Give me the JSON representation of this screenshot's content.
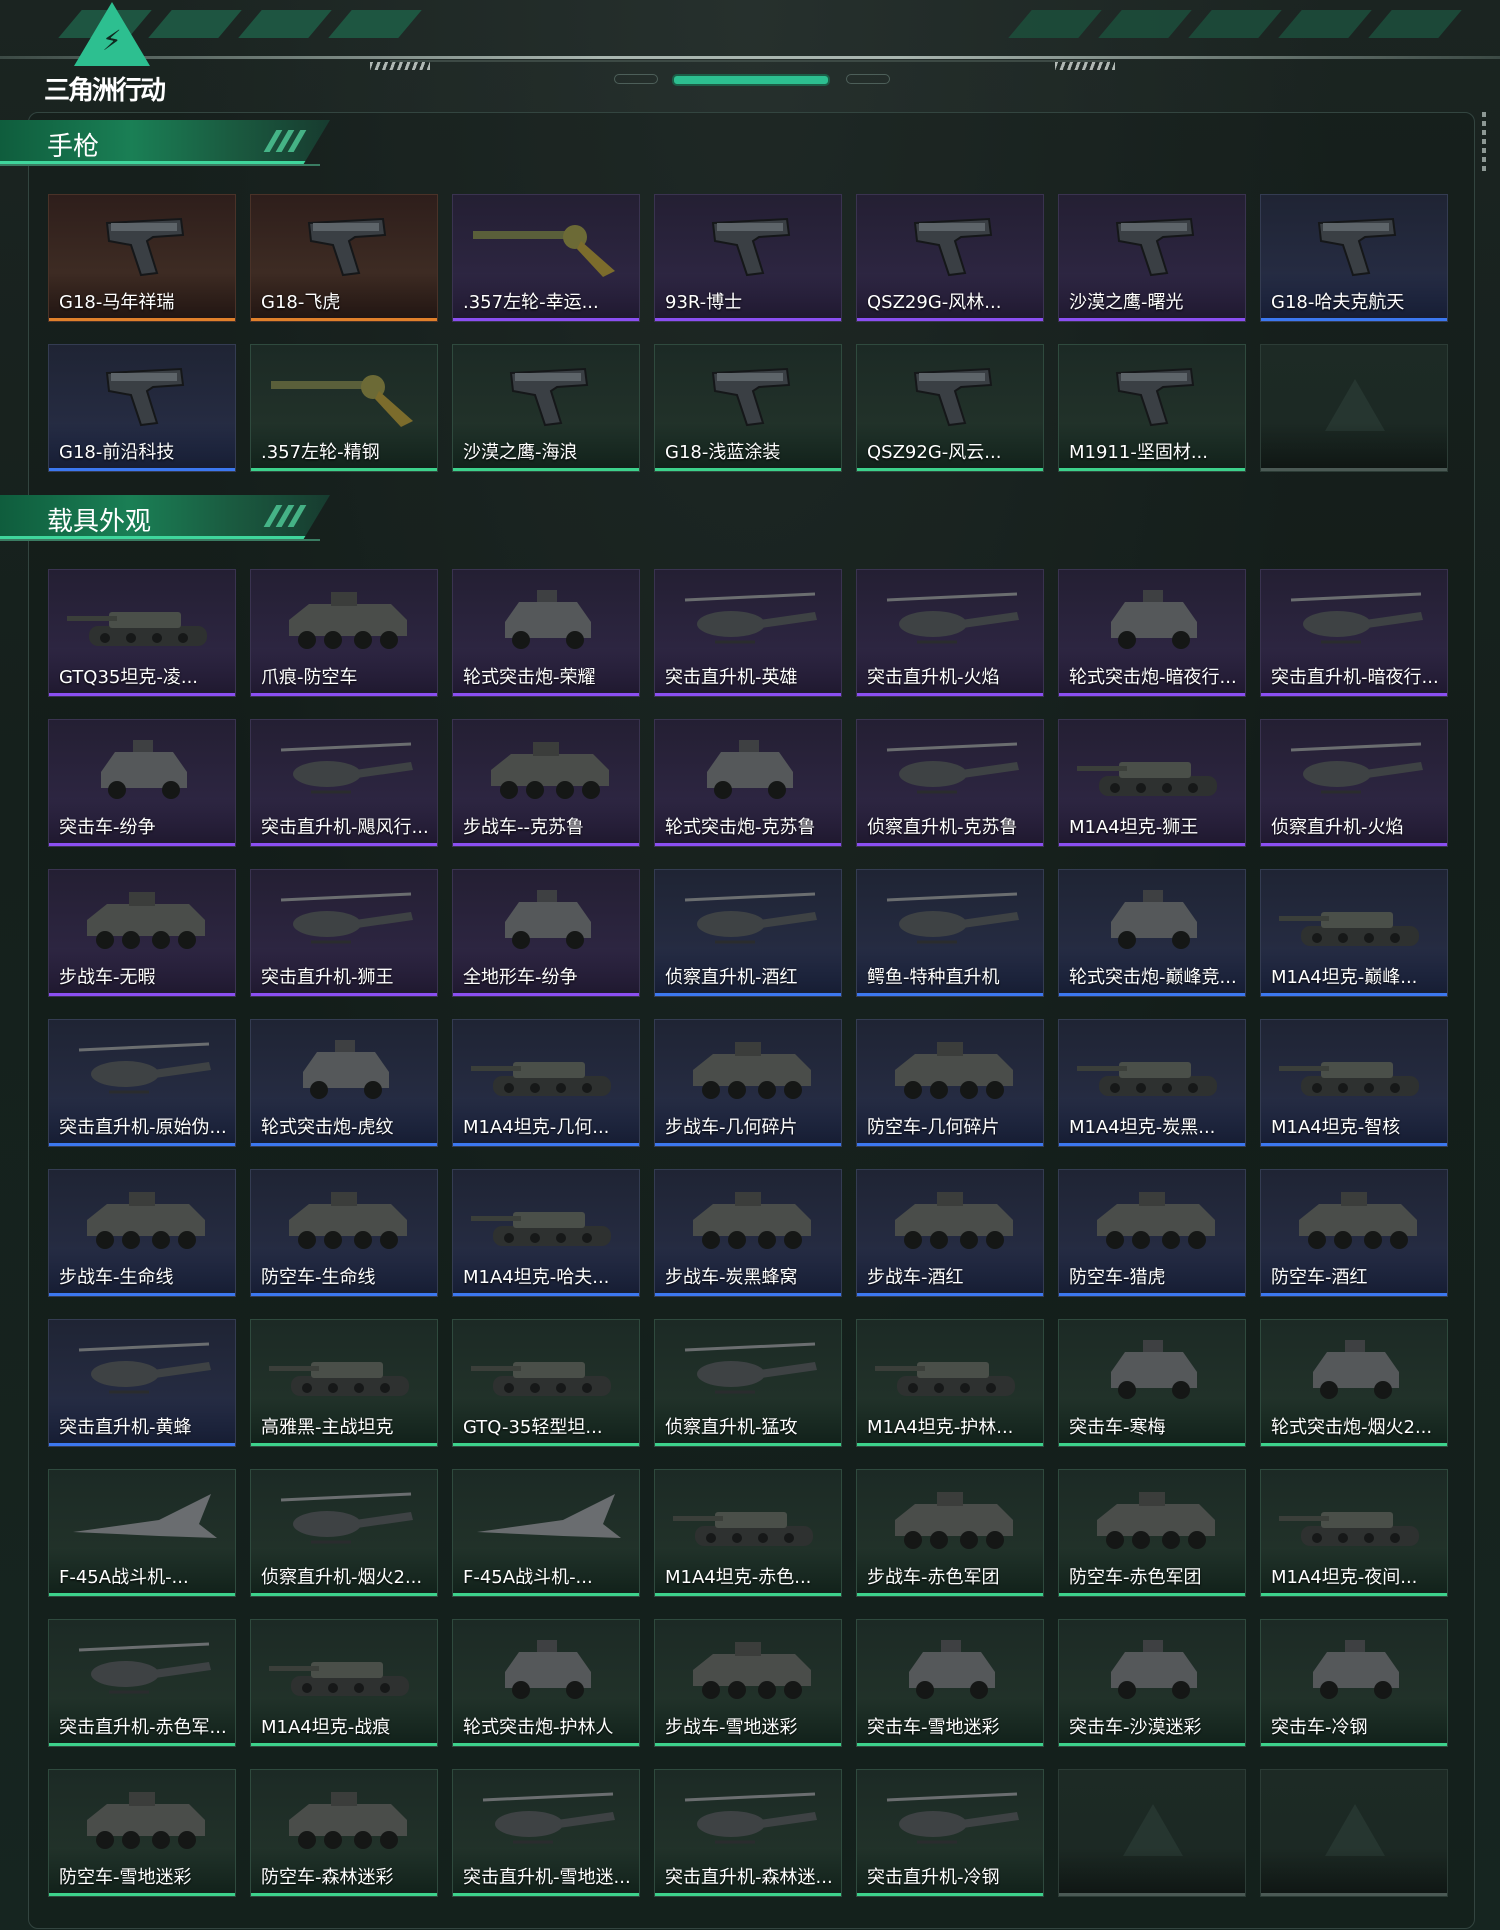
{
  "header": {
    "logo_text": "三角洲行动",
    "logo_glyph": "⚡"
  },
  "colors": {
    "accent": "#2dbf90",
    "orange": "#e0802b",
    "purple": "#8b4ff2",
    "blue": "#3c78f0",
    "green": "#3dd28c"
  },
  "sections": [
    {
      "title": "手枪",
      "items": [
        {
          "name": "G18-马年祥瑞",
          "tier": "orange",
          "kind": "pistol"
        },
        {
          "name": "G18-飞虎",
          "tier": "orange",
          "kind": "pistol"
        },
        {
          "name": ".357左轮-幸运...",
          "tier": "purple",
          "kind": "revolver"
        },
        {
          "name": "93R-博士",
          "tier": "purple",
          "kind": "pistol"
        },
        {
          "name": "QSZ29G-风林...",
          "tier": "purple",
          "kind": "pistol"
        },
        {
          "name": "沙漠之鹰-曙光",
          "tier": "purple",
          "kind": "pistol"
        },
        {
          "name": "G18-哈夫克航天",
          "tier": "blue",
          "kind": "pistol"
        },
        {
          "name": "G18-前沿科技",
          "tier": "blue",
          "kind": "pistol"
        },
        {
          "name": ".357左轮-精钢",
          "tier": "green",
          "kind": "revolver"
        },
        {
          "name": "沙漠之鹰-海浪",
          "tier": "green",
          "kind": "pistol"
        },
        {
          "name": "G18-浅蓝涂装",
          "tier": "green",
          "kind": "pistol"
        },
        {
          "name": "QSZ92G-风云...",
          "tier": "green",
          "kind": "pistol"
        },
        {
          "name": "M1911-坚固材...",
          "tier": "green",
          "kind": "pistol"
        },
        {
          "name": "",
          "tier": "empty",
          "kind": "empty"
        }
      ]
    },
    {
      "title": "载具外观",
      "items": [
        {
          "name": "GTQ35坦克-凌...",
          "tier": "purple",
          "kind": "tank"
        },
        {
          "name": "爪痕-防空车",
          "tier": "purple",
          "kind": "apc"
        },
        {
          "name": "轮式突击炮-荣耀",
          "tier": "purple",
          "kind": "car"
        },
        {
          "name": "突击直升机-英雄",
          "tier": "purple",
          "kind": "heli"
        },
        {
          "name": "突击直升机-火焰",
          "tier": "purple",
          "kind": "heli"
        },
        {
          "name": "轮式突击炮-暗夜行...",
          "tier": "purple",
          "kind": "car"
        },
        {
          "name": "突击直升机-暗夜行...",
          "tier": "purple",
          "kind": "heli"
        },
        {
          "name": "突击车-纷争",
          "tier": "purple",
          "kind": "car"
        },
        {
          "name": "突击直升机-飓风行...",
          "tier": "purple",
          "kind": "heli"
        },
        {
          "name": "步战车--克苏鲁",
          "tier": "purple",
          "kind": "apc"
        },
        {
          "name": "轮式突击炮-克苏鲁",
          "tier": "purple",
          "kind": "car"
        },
        {
          "name": "侦察直升机-克苏鲁",
          "tier": "purple",
          "kind": "heli"
        },
        {
          "name": "M1A4坦克-狮王",
          "tier": "purple",
          "kind": "tank"
        },
        {
          "name": "侦察直升机-火焰",
          "tier": "purple",
          "kind": "heli"
        },
        {
          "name": "步战车-无暇",
          "tier": "purple",
          "kind": "apc"
        },
        {
          "name": "突击直升机-狮王",
          "tier": "purple",
          "kind": "heli"
        },
        {
          "name": "全地形车-纷争",
          "tier": "purple",
          "kind": "car"
        },
        {
          "name": "侦察直升机-酒红",
          "tier": "blue",
          "kind": "heli"
        },
        {
          "name": "鳄鱼-特种直升机",
          "tier": "blue",
          "kind": "heli"
        },
        {
          "name": "轮式突击炮-巅峰竞...",
          "tier": "blue",
          "kind": "car"
        },
        {
          "name": "M1A4坦克-巅峰...",
          "tier": "blue",
          "kind": "tank"
        },
        {
          "name": "突击直升机-原始伪...",
          "tier": "blue",
          "kind": "heli"
        },
        {
          "name": "轮式突击炮-虎纹",
          "tier": "blue",
          "kind": "car"
        },
        {
          "name": "M1A4坦克-几何...",
          "tier": "blue",
          "kind": "tank"
        },
        {
          "name": "步战车-几何碎片",
          "tier": "blue",
          "kind": "apc"
        },
        {
          "name": "防空车-几何碎片",
          "tier": "blue",
          "kind": "apc"
        },
        {
          "name": "M1A4坦克-炭黑...",
          "tier": "blue",
          "kind": "tank"
        },
        {
          "name": "M1A4坦克-智核",
          "tier": "blue",
          "kind": "tank"
        },
        {
          "name": "步战车-生命线",
          "tier": "blue",
          "kind": "apc"
        },
        {
          "name": "防空车-生命线",
          "tier": "blue",
          "kind": "apc"
        },
        {
          "name": "M1A4坦克-哈夫...",
          "tier": "blue",
          "kind": "tank"
        },
        {
          "name": "步战车-炭黑蜂窝",
          "tier": "blue",
          "kind": "apc"
        },
        {
          "name": "步战车-酒红",
          "tier": "blue",
          "kind": "apc"
        },
        {
          "name": "防空车-猎虎",
          "tier": "blue",
          "kind": "apc"
        },
        {
          "name": "防空车-酒红",
          "tier": "blue",
          "kind": "apc"
        },
        {
          "name": "突击直升机-黄蜂",
          "tier": "blue",
          "kind": "heli"
        },
        {
          "name": "高雅黑-主战坦克",
          "tier": "green",
          "kind": "tank"
        },
        {
          "name": "GTQ-35轻型坦...",
          "tier": "green",
          "kind": "tank"
        },
        {
          "name": "侦察直升机-猛攻",
          "tier": "green",
          "kind": "heli"
        },
        {
          "name": "M1A4坦克-护林...",
          "tier": "green",
          "kind": "tank"
        },
        {
          "name": "突击车-寒梅",
          "tier": "green",
          "kind": "car"
        },
        {
          "name": "轮式突击炮-烟火2...",
          "tier": "green",
          "kind": "car"
        },
        {
          "name": "F-45A战斗机-...",
          "tier": "green",
          "kind": "jet"
        },
        {
          "name": "侦察直升机-烟火2...",
          "tier": "green",
          "kind": "heli"
        },
        {
          "name": "F-45A战斗机-...",
          "tier": "green",
          "kind": "jet"
        },
        {
          "name": "M1A4坦克-赤色...",
          "tier": "green",
          "kind": "tank"
        },
        {
          "name": "步战车-赤色军团",
          "tier": "green",
          "kind": "apc"
        },
        {
          "name": "防空车-赤色军团",
          "tier": "green",
          "kind": "apc"
        },
        {
          "name": "M1A4坦克-夜间...",
          "tier": "green",
          "kind": "tank"
        },
        {
          "name": "突击直升机-赤色军...",
          "tier": "green",
          "kind": "heli"
        },
        {
          "name": "M1A4坦克-战痕",
          "tier": "green",
          "kind": "tank"
        },
        {
          "name": "轮式突击炮-护林人",
          "tier": "green",
          "kind": "car"
        },
        {
          "name": "步战车-雪地迷彩",
          "tier": "green",
          "kind": "apc"
        },
        {
          "name": "突击车-雪地迷彩",
          "tier": "green",
          "kind": "car"
        },
        {
          "name": "突击车-沙漠迷彩",
          "tier": "green",
          "kind": "car"
        },
        {
          "name": "突击车-冷钢",
          "tier": "green",
          "kind": "car"
        },
        {
          "name": "防空车-雪地迷彩",
          "tier": "green",
          "kind": "apc"
        },
        {
          "name": "防空车-森林迷彩",
          "tier": "green",
          "kind": "apc"
        },
        {
          "name": "突击直升机-雪地迷...",
          "tier": "green",
          "kind": "heli"
        },
        {
          "name": "突击直升机-森林迷...",
          "tier": "green",
          "kind": "heli"
        },
        {
          "name": "突击直升机-冷钢",
          "tier": "green",
          "kind": "heli"
        },
        {
          "name": "",
          "tier": "empty",
          "kind": "empty"
        },
        {
          "name": "",
          "tier": "empty",
          "kind": "empty"
        }
      ]
    }
  ]
}
